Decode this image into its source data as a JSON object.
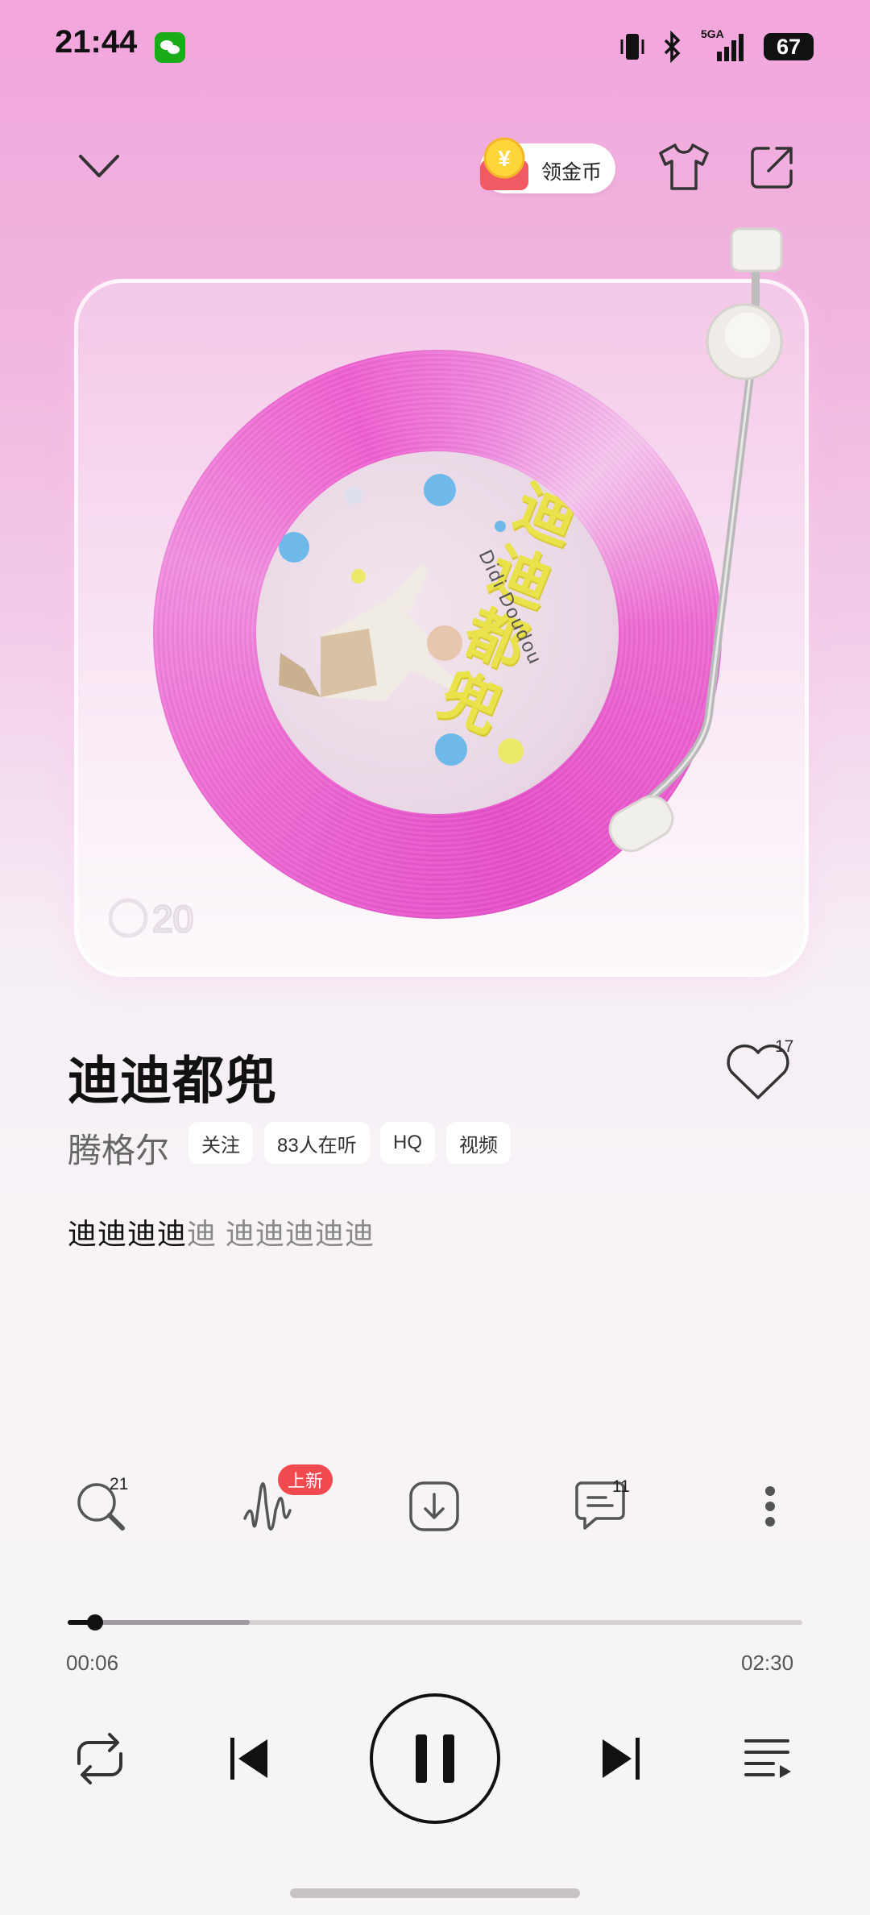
{
  "status_bar": {
    "time": "21:44",
    "battery": "67",
    "network": "5GA"
  },
  "header": {
    "coin_label": "领金币",
    "coin_symbol": "¥"
  },
  "album": {
    "cover_title": "迪迪都兜",
    "cover_subtitle": "Didi Doudou",
    "logo": "20"
  },
  "song": {
    "title": "迪迪都兜",
    "artist": "腾格尔",
    "chips": [
      "关注",
      "83人在听",
      "HQ",
      "视频"
    ],
    "like_count": "17",
    "lyric_highlight": "迪迪迪迪",
    "lyric_rest": "迪 迪迪迪迪迪"
  },
  "actions": {
    "search_count": "21",
    "new_badge": "上新",
    "comment_count": "11"
  },
  "progress": {
    "current": "00:06",
    "total": "02:30",
    "played_fraction": 0.04,
    "buffered_fraction": 0.25
  },
  "colors": {
    "accent_pink": "#ee5fd0",
    "badge_red": "#f0494f"
  },
  "icons": [
    "chevron-down-icon",
    "coin-icon",
    "tshirt-icon",
    "share-icon",
    "heart-icon",
    "search-icon",
    "soundwave-icon",
    "download-icon",
    "comment-icon",
    "more-icon",
    "repeat-icon",
    "previous-icon",
    "pause-icon",
    "next-icon",
    "playlist-icon"
  ]
}
